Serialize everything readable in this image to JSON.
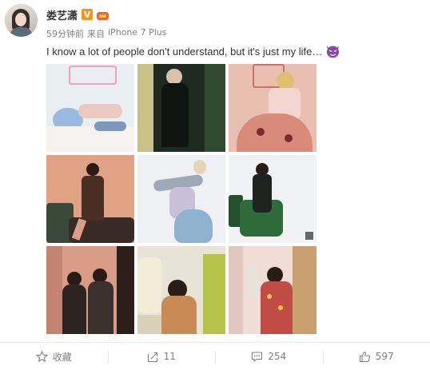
{
  "post": {
    "username": "娄艺潇",
    "vip_badge": "V",
    "time": "59分钟前",
    "source_prefix": "来自",
    "source": "iPhone 7 Plus",
    "text": "I know a lot of people don't understand, but it's just my life…"
  },
  "photos": [
    {
      "id": 1,
      "desc": "pink-hair-lying"
    },
    {
      "id": 2,
      "desc": "dark-green-mirror"
    },
    {
      "id": 3,
      "desc": "pink-cart-dress"
    },
    {
      "id": 4,
      "desc": "orange-wall-sofa"
    },
    {
      "id": 5,
      "desc": "white-studio-fur"
    },
    {
      "id": 6,
      "desc": "green-sofa-white"
    },
    {
      "id": 7,
      "desc": "two-mirror-fur"
    },
    {
      "id": 8,
      "desc": "wardrobe-clothes"
    },
    {
      "id": 9,
      "desc": "pink-clothes-rack"
    }
  ],
  "actions": {
    "favorite_label": "收藏",
    "repost_count": "11",
    "comment_count": "254",
    "like_count": "597"
  },
  "colors": {
    "text": "#333333",
    "meta": "#808080",
    "vip": "#f7931e",
    "divider": "#eaeaea"
  }
}
